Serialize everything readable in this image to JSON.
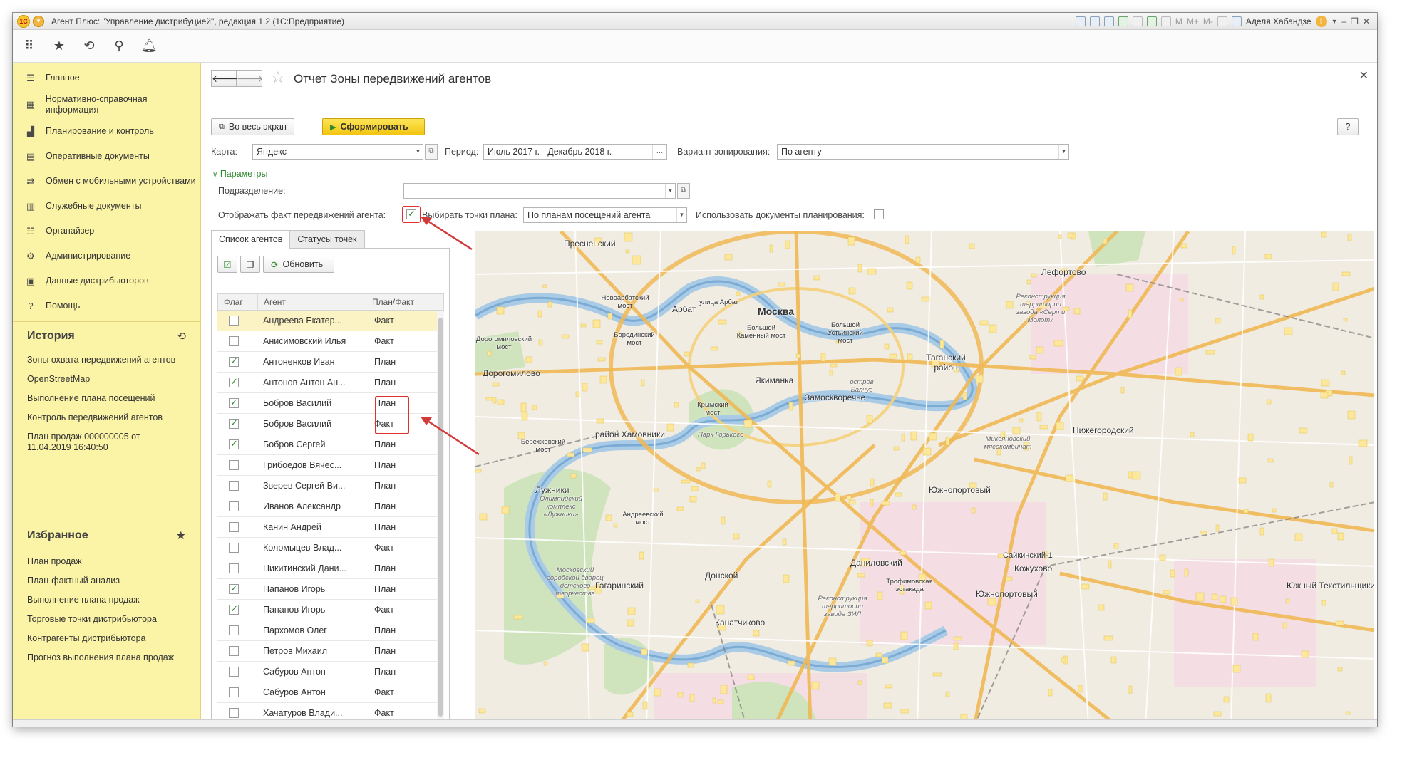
{
  "window": {
    "title": "Агент Плюс: \"Управление дистрибуцией\", редакция 1.2 (1С:Предприятие)",
    "user": "Аделя Хабандзе",
    "toolbar_marks": [
      "M",
      "M+",
      "M-"
    ]
  },
  "sidebar": {
    "items": [
      {
        "label": "Главное",
        "icon": "menu-lines-icon"
      },
      {
        "label": "Нормативно-справочная информация",
        "icon": "catalog-icon"
      },
      {
        "label": "Планирование и контроль",
        "icon": "bar-chart-icon"
      },
      {
        "label": "Оперативные документы",
        "icon": "documents-icon"
      },
      {
        "label": "Обмен с мобильными устройствами",
        "icon": "exchange-icon"
      },
      {
        "label": "Служебные документы",
        "icon": "service-docs-icon"
      },
      {
        "label": "Органайзер",
        "icon": "organizer-icon"
      },
      {
        "label": "Администрирование",
        "icon": "gear-icon"
      },
      {
        "label": "Данные дистрибьюторов",
        "icon": "distributors-icon"
      },
      {
        "label": "Помощь",
        "icon": "question-icon"
      }
    ],
    "history": {
      "title": "История",
      "items": [
        "Зоны охвата передвижений агентов",
        "OpenStreetMap",
        "Выполнение плана посещений",
        "Контроль передвижений агентов",
        "План продаж 000000005 от 11.04.2019 16:40:50"
      ]
    },
    "favorites": {
      "title": "Избранное",
      "items": [
        "План продаж",
        "План-фактный анализ",
        "Выполнение плана продаж",
        "Торговые точки дистрибьютора",
        "Контрагенты дистрибьютора",
        "Прогноз выполнения плана продаж"
      ]
    }
  },
  "form": {
    "title": "Отчет Зоны передвижений агентов",
    "fullscreen_label": "Во весь экран",
    "generate_label": "Сформировать",
    "help_label": "?",
    "map_label": "Карта:",
    "map_value": "Яндекс",
    "period_label": "Период:",
    "period_value": "Июль 2017 г. - Декабрь 2018 г.",
    "zoning_label": "Вариант зонирования:",
    "zoning_value": "По агенту",
    "params_label": "Параметры",
    "division_label": "Подразделение:",
    "division_value": "",
    "show_fact_label": "Отображать факт передвижений агента:",
    "show_fact_checked": true,
    "plan_points_label": "Выбирать точки плана:",
    "plan_points_value": "По планам посещений агента",
    "use_docs_label": "Использовать документы планирования:",
    "use_docs_checked": false
  },
  "tabs": [
    {
      "label": "Список агентов",
      "active": true
    },
    {
      "label": "Статусы точек",
      "active": false
    }
  ],
  "list_toolbar": {
    "refresh_label": "Обновить"
  },
  "table": {
    "headers": [
      "Флаг",
      "Агент",
      "План/Факт"
    ],
    "rows": [
      {
        "checked": false,
        "agent": "Андреева Екатер...",
        "type": "Факт"
      },
      {
        "checked": false,
        "agent": "Анисимовский Илья",
        "type": "Факт"
      },
      {
        "checked": true,
        "agent": "Антоненков Иван",
        "type": "План"
      },
      {
        "checked": true,
        "agent": "Антонов Антон Ан...",
        "type": "План"
      },
      {
        "checked": true,
        "agent": "Бобров Василий",
        "type": "План"
      },
      {
        "checked": true,
        "agent": "Бобров Василий",
        "type": "Факт"
      },
      {
        "checked": true,
        "agent": "Бобров Сергей",
        "type": "План"
      },
      {
        "checked": false,
        "agent": "Грибоедов Вячес...",
        "type": "План"
      },
      {
        "checked": false,
        "agent": "Зверев Сергей Ви...",
        "type": "План"
      },
      {
        "checked": false,
        "agent": "Иванов Александр",
        "type": "План"
      },
      {
        "checked": false,
        "agent": "Канин Андрей",
        "type": "План"
      },
      {
        "checked": false,
        "agent": "Коломыцев Влад...",
        "type": "Факт"
      },
      {
        "checked": false,
        "agent": "Никитинский Дани...",
        "type": "План"
      },
      {
        "checked": true,
        "agent": "Папанов Игорь",
        "type": "План"
      },
      {
        "checked": true,
        "agent": "Папанов Игорь",
        "type": "Факт"
      },
      {
        "checked": false,
        "agent": "Пархомов Олег",
        "type": "План"
      },
      {
        "checked": false,
        "agent": "Петров Михаил",
        "type": "План"
      },
      {
        "checked": false,
        "agent": "Сабуров Антон",
        "type": "План"
      },
      {
        "checked": false,
        "agent": "Сабуров Антон",
        "type": "Факт"
      },
      {
        "checked": false,
        "agent": "Хачатуров Влади...",
        "type": "Факт"
      }
    ]
  },
  "map": {
    "labels": {
      "presnensky": "Пресненский",
      "lefortovo": "Лефортово",
      "novoarbat_bridge": "Новоарбатский мост",
      "arbat": "Арбат",
      "arbat_street": "улица Арбат",
      "moscow": "Москва",
      "borodinsky_bridge": "Бородинский мост",
      "bolshoy_kamenny": "Большой Каменный мост",
      "bolshoy_ustinsky": "Большой Устьинский мост",
      "kutuzovsky_bridge": "Дорогомиловский мост",
      "dorogomilovo": "Дорогомилово",
      "yakimanka": "Якиманка",
      "zamoskvorechye": "Замоскворечье",
      "taganka": "Таганский район",
      "krymsky_bridge": "Крымский мост",
      "khamovniki": "район Хамовники",
      "gorky_park": "Парк Горького",
      "berezhkovsky_bridge": "Бережковский мост",
      "nizhegorodsky": "Нижегородский",
      "luzhniki": "Лужники",
      "luzhniki_complex": "Олимпийский комплекс «Лужники»",
      "yuzhnoportovy": "Южнопортовый",
      "andreevsky_bridge": "Андреевский мост",
      "danilovsky": "Даниловский",
      "donskoy": "Донской",
      "sayk1": "Сайкинский-1",
      "kozhukhovo": "Кожухово",
      "gagarinsky": "Гагаринский",
      "trofimovskaya": "Трофимовская эстакада",
      "yuzhnoportovy2": "Южнопортовый",
      "kanatchikovo": "Канатчиково",
      "yuzh_tekst": "Южный Текстильщики",
      "serp_molot": "Реконструкция территории завода «Серп и Молот»",
      "mmk": "Микояновский мясокомбинат",
      "zil": "Реконструкция территории завода ЗИЛ",
      "ostrov_baltschug": "остров Балчуг",
      "moscow_palace": "Московский городской дворец детского творчества"
    }
  },
  "colors": {
    "sidebar_bg": "#fbf3a6",
    "accent_yellow": "#f7d12a",
    "check_green": "#2d8a2d",
    "highlight_red": "#e03030"
  }
}
